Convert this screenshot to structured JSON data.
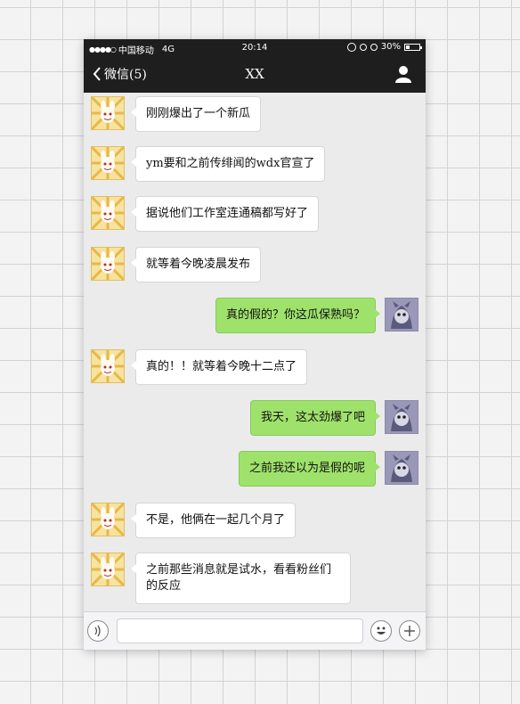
{
  "statusbar": {
    "carrier": "中国移动",
    "network": "4G",
    "time": "20:14",
    "battery": "30%",
    "battery_level": 0.3
  },
  "nav": {
    "back_label": "微信(5)",
    "title": "XX"
  },
  "messages": [
    {
      "side": "in",
      "text": "刚刚爆出了一个新瓜"
    },
    {
      "side": "in",
      "text": "ym要和之前传绯闻的wdx官宣了"
    },
    {
      "side": "in",
      "text": "据说他们工作室连通稿都写好了"
    },
    {
      "side": "in",
      "text": "就等着今晚凌晨发布"
    },
    {
      "side": "out",
      "text": "真的假的？你这瓜保熟吗？"
    },
    {
      "side": "in",
      "text": "真的！！就等着今晚十二点了"
    },
    {
      "side": "out",
      "text": "我天，这太劲爆了吧"
    },
    {
      "side": "out",
      "text": "之前我还以为是假的呢"
    },
    {
      "side": "in",
      "text": "不是，他俩在一起几个月了"
    },
    {
      "side": "in",
      "text": "之前那些消息就是试水，看看粉丝们的反应"
    }
  ],
  "input": {
    "value": "",
    "placeholder": ""
  },
  "colors": {
    "outgoing_bubble": "#9fe26b",
    "incoming_bubble": "#ffffff",
    "bar": "#1e1e1e"
  },
  "icons": {
    "back": "chevron-left-icon",
    "profile": "person-icon",
    "voice": "voice-icon",
    "emoji": "smiley-icon",
    "more": "plus-icon"
  }
}
